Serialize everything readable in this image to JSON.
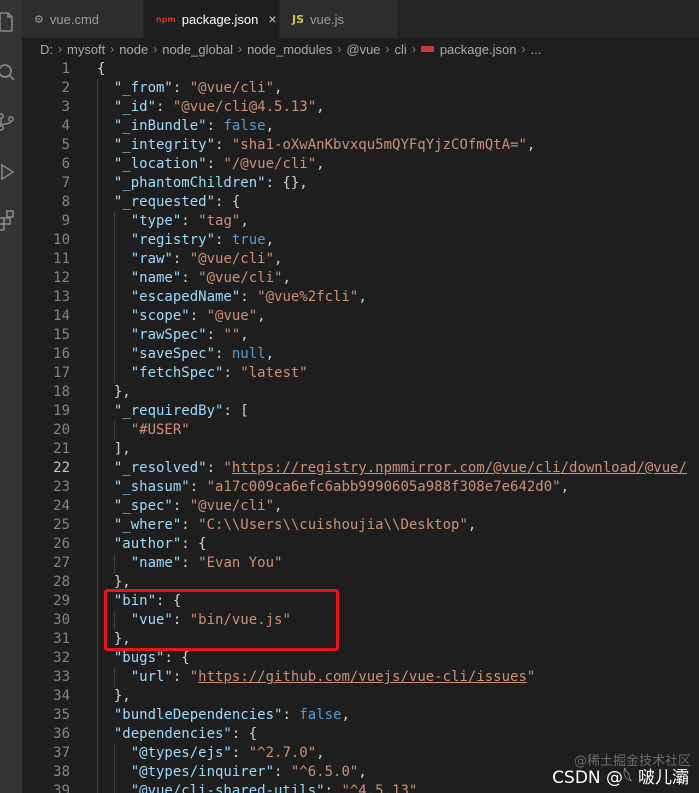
{
  "tabs": [
    {
      "icon": "⚙",
      "label": "vue.cmd",
      "active": false
    },
    {
      "icon": "npm",
      "label": "package.json",
      "active": true,
      "close": "×"
    },
    {
      "icon": "JS",
      "label": "vue.js",
      "active": false
    }
  ],
  "breadcrumb": [
    "D:",
    "mysoft",
    "node",
    "node_global",
    "node_modules",
    "@vue",
    "cli",
    "package.json",
    "..."
  ],
  "breadcrumb_sep": "›",
  "colors": {
    "key": "#9cdcfe",
    "string": "#ce9178",
    "boolean": "#569cd6",
    "punct": "#d4d4d4",
    "highlight": "#e8141b"
  },
  "current_line": 22,
  "lines": [
    {
      "n": 1,
      "indent": 0,
      "tokens": [
        [
          "p",
          "{"
        ]
      ]
    },
    {
      "n": 2,
      "indent": 1,
      "tokens": [
        [
          "k",
          "\"_from\""
        ],
        [
          "p",
          ": "
        ],
        [
          "s",
          "\"@vue/cli\""
        ],
        [
          "p",
          ","
        ]
      ]
    },
    {
      "n": 3,
      "indent": 1,
      "tokens": [
        [
          "k",
          "\"_id\""
        ],
        [
          "p",
          ": "
        ],
        [
          "s",
          "\"@vue/cli@4.5.13\""
        ],
        [
          "p",
          ","
        ]
      ]
    },
    {
      "n": 4,
      "indent": 1,
      "tokens": [
        [
          "k",
          "\"_inBundle\""
        ],
        [
          "p",
          ": "
        ],
        [
          "b",
          "false"
        ],
        [
          "p",
          ","
        ]
      ]
    },
    {
      "n": 5,
      "indent": 1,
      "tokens": [
        [
          "k",
          "\"_integrity\""
        ],
        [
          "p",
          ": "
        ],
        [
          "s",
          "\"sha1-oXwAnKbvxqu5mQYFqYjzCOfmQtA=\""
        ],
        [
          "p",
          ","
        ]
      ]
    },
    {
      "n": 6,
      "indent": 1,
      "tokens": [
        [
          "k",
          "\"_location\""
        ],
        [
          "p",
          ": "
        ],
        [
          "s",
          "\"/@vue/cli\""
        ],
        [
          "p",
          ","
        ]
      ]
    },
    {
      "n": 7,
      "indent": 1,
      "tokens": [
        [
          "k",
          "\"_phantomChildren\""
        ],
        [
          "p",
          ": {},"
        ]
      ]
    },
    {
      "n": 8,
      "indent": 1,
      "tokens": [
        [
          "k",
          "\"_requested\""
        ],
        [
          "p",
          ": {"
        ]
      ]
    },
    {
      "n": 9,
      "indent": 2,
      "tokens": [
        [
          "k",
          "\"type\""
        ],
        [
          "p",
          ": "
        ],
        [
          "s",
          "\"tag\""
        ],
        [
          "p",
          ","
        ]
      ]
    },
    {
      "n": 10,
      "indent": 2,
      "tokens": [
        [
          "k",
          "\"registry\""
        ],
        [
          "p",
          ": "
        ],
        [
          "b",
          "true"
        ],
        [
          "p",
          ","
        ]
      ]
    },
    {
      "n": 11,
      "indent": 2,
      "tokens": [
        [
          "k",
          "\"raw\""
        ],
        [
          "p",
          ": "
        ],
        [
          "s",
          "\"@vue/cli\""
        ],
        [
          "p",
          ","
        ]
      ]
    },
    {
      "n": 12,
      "indent": 2,
      "tokens": [
        [
          "k",
          "\"name\""
        ],
        [
          "p",
          ": "
        ],
        [
          "s",
          "\"@vue/cli\""
        ],
        [
          "p",
          ","
        ]
      ]
    },
    {
      "n": 13,
      "indent": 2,
      "tokens": [
        [
          "k",
          "\"escapedName\""
        ],
        [
          "p",
          ": "
        ],
        [
          "s",
          "\"@vue%2fcli\""
        ],
        [
          "p",
          ","
        ]
      ]
    },
    {
      "n": 14,
      "indent": 2,
      "tokens": [
        [
          "k",
          "\"scope\""
        ],
        [
          "p",
          ": "
        ],
        [
          "s",
          "\"@vue\""
        ],
        [
          "p",
          ","
        ]
      ]
    },
    {
      "n": 15,
      "indent": 2,
      "tokens": [
        [
          "k",
          "\"rawSpec\""
        ],
        [
          "p",
          ": "
        ],
        [
          "s",
          "\"\""
        ],
        [
          "p",
          ","
        ]
      ]
    },
    {
      "n": 16,
      "indent": 2,
      "tokens": [
        [
          "k",
          "\"saveSpec\""
        ],
        [
          "p",
          ": "
        ],
        [
          "b",
          "null"
        ],
        [
          "p",
          ","
        ]
      ]
    },
    {
      "n": 17,
      "indent": 2,
      "tokens": [
        [
          "k",
          "\"fetchSpec\""
        ],
        [
          "p",
          ": "
        ],
        [
          "s",
          "\"latest\""
        ]
      ]
    },
    {
      "n": 18,
      "indent": 1,
      "tokens": [
        [
          "p",
          "},"
        ]
      ]
    },
    {
      "n": 19,
      "indent": 1,
      "tokens": [
        [
          "k",
          "\"_requiredBy\""
        ],
        [
          "p",
          ": ["
        ]
      ]
    },
    {
      "n": 20,
      "indent": 2,
      "tokens": [
        [
          "s",
          "\"#USER\""
        ]
      ]
    },
    {
      "n": 21,
      "indent": 1,
      "tokens": [
        [
          "p",
          "],"
        ]
      ]
    },
    {
      "n": 22,
      "indent": 1,
      "tokens": [
        [
          "k",
          "\"_resolved\""
        ],
        [
          "p",
          ": "
        ],
        [
          "s",
          "\""
        ],
        [
          "u",
          "https://registry.npmmirror.com/@vue/cli/download/@vue/"
        ]
      ]
    },
    {
      "n": 23,
      "indent": 1,
      "tokens": [
        [
          "k",
          "\"_shasum\""
        ],
        [
          "p",
          ": "
        ],
        [
          "s",
          "\"a17c009ca6efc6abb9990605a988f308e7e642d0\""
        ],
        [
          "p",
          ","
        ]
      ]
    },
    {
      "n": 24,
      "indent": 1,
      "tokens": [
        [
          "k",
          "\"_spec\""
        ],
        [
          "p",
          ": "
        ],
        [
          "s",
          "\"@vue/cli\""
        ],
        [
          "p",
          ","
        ]
      ]
    },
    {
      "n": 25,
      "indent": 1,
      "tokens": [
        [
          "k",
          "\"_where\""
        ],
        [
          "p",
          ": "
        ],
        [
          "s",
          "\"C:\\\\Users\\\\cuishoujia\\\\Desktop\""
        ],
        [
          "p",
          ","
        ]
      ]
    },
    {
      "n": 26,
      "indent": 1,
      "tokens": [
        [
          "k",
          "\"author\""
        ],
        [
          "p",
          ": {"
        ]
      ]
    },
    {
      "n": 27,
      "indent": 2,
      "tokens": [
        [
          "k",
          "\"name\""
        ],
        [
          "p",
          ": "
        ],
        [
          "s",
          "\"Evan You\""
        ]
      ]
    },
    {
      "n": 28,
      "indent": 1,
      "tokens": [
        [
          "p",
          "},"
        ]
      ]
    },
    {
      "n": 29,
      "indent": 1,
      "tokens": [
        [
          "k",
          "\"bin\""
        ],
        [
          "p",
          ": {"
        ]
      ]
    },
    {
      "n": 30,
      "indent": 2,
      "tokens": [
        [
          "k",
          "\"vue\""
        ],
        [
          "p",
          ": "
        ],
        [
          "s",
          "\"bin/vue.js\""
        ]
      ]
    },
    {
      "n": 31,
      "indent": 1,
      "tokens": [
        [
          "p",
          "},"
        ]
      ]
    },
    {
      "n": 32,
      "indent": 1,
      "tokens": [
        [
          "k",
          "\"bugs\""
        ],
        [
          "p",
          ": {"
        ]
      ]
    },
    {
      "n": 33,
      "indent": 2,
      "tokens": [
        [
          "k",
          "\"url\""
        ],
        [
          "p",
          ": "
        ],
        [
          "s",
          "\""
        ],
        [
          "u",
          "https://github.com/vuejs/vue-cli/issues"
        ],
        [
          "s",
          "\""
        ]
      ]
    },
    {
      "n": 34,
      "indent": 1,
      "tokens": [
        [
          "p",
          "},"
        ]
      ]
    },
    {
      "n": 35,
      "indent": 1,
      "tokens": [
        [
          "k",
          "\"bundleDependencies\""
        ],
        [
          "p",
          ": "
        ],
        [
          "b",
          "false"
        ],
        [
          "p",
          ","
        ]
      ]
    },
    {
      "n": 36,
      "indent": 1,
      "tokens": [
        [
          "k",
          "\"dependencies\""
        ],
        [
          "p",
          ": {"
        ]
      ]
    },
    {
      "n": 37,
      "indent": 2,
      "tokens": [
        [
          "k",
          "\"@types/ejs\""
        ],
        [
          "p",
          ": "
        ],
        [
          "s",
          "\"^2.7.0\""
        ],
        [
          "p",
          ","
        ]
      ]
    },
    {
      "n": 38,
      "indent": 2,
      "tokens": [
        [
          "k",
          "\"@types/inquirer\""
        ],
        [
          "p",
          ": "
        ],
        [
          "s",
          "\"^6.5.0\""
        ],
        [
          "p",
          ","
        ]
      ]
    },
    {
      "n": 39,
      "indent": 2,
      "tokens": [
        [
          "k",
          "\"@vue/cli-shared-utils\""
        ],
        [
          "p",
          ": "
        ],
        [
          "s",
          "\"^4.5.13\""
        ]
      ]
    }
  ],
  "watermark": {
    "line1": "@稀土掘金技术社区",
    "line2": "CSDN @𓆩 啵儿灞"
  }
}
